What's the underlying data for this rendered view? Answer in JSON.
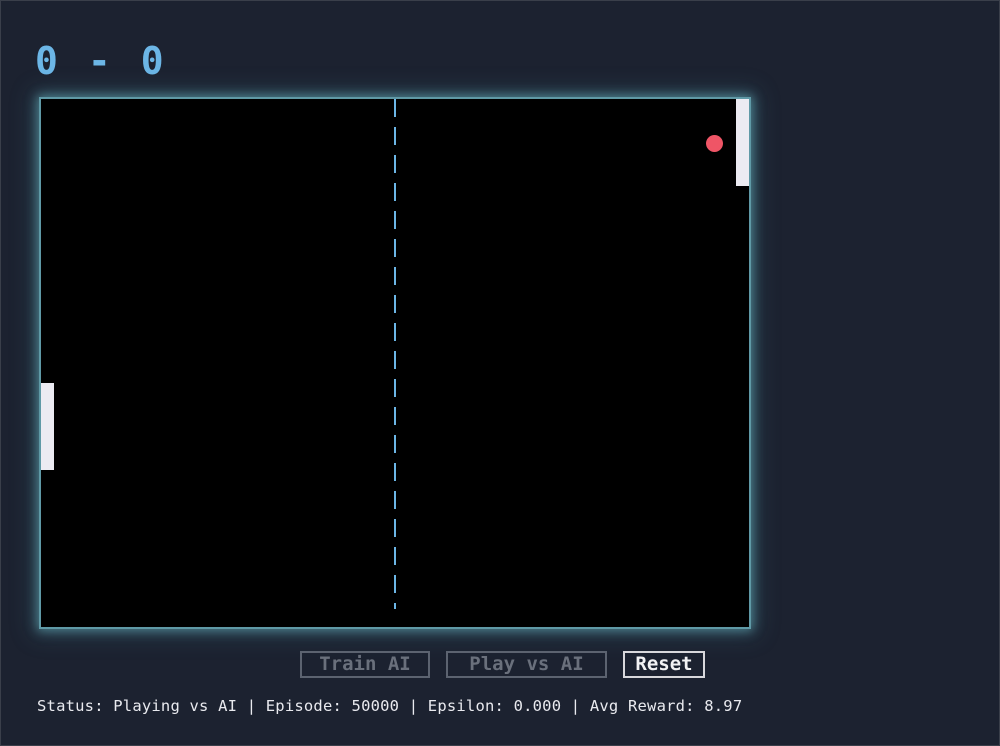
{
  "scoreboard": {
    "left_score": "0",
    "separator": "-",
    "right_score": "0"
  },
  "game": {
    "center_line": "dashed",
    "colors": {
      "background": "#1c2230",
      "court": "#000000",
      "court_glow": "#6ebec8",
      "score": "#6cb6e6",
      "paddle": "#ecebf2",
      "ball": "#ef5566"
    }
  },
  "controls": {
    "train_label": "Train AI",
    "play_label": "Play vs AI",
    "reset_label": "Reset"
  },
  "status_bar": {
    "text": "Status: Playing vs AI | Episode: 50000 | Epsilon: 0.000 | Avg Reward: 8.97"
  }
}
